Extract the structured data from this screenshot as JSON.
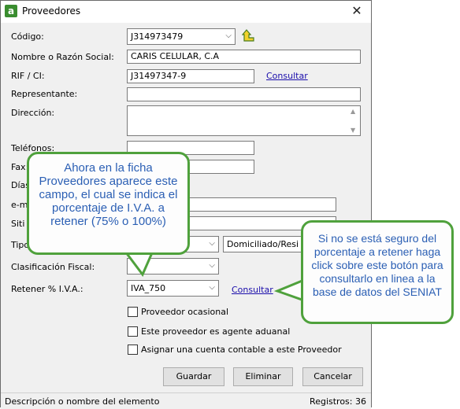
{
  "window": {
    "title": "Proveedores",
    "app_icon_letter": "a",
    "close_glyph": "✕"
  },
  "form": {
    "codigo": {
      "label": "Código:",
      "value": "J314973479"
    },
    "nombre": {
      "label": "Nombre o Razón Social:",
      "value": "CARIS CELULAR, C.A"
    },
    "rif": {
      "label": "RIF / CI:",
      "value": "J31497347-9",
      "link": "Consultar"
    },
    "representante": {
      "label": "Representante:",
      "value": ""
    },
    "direccion": {
      "label": "Dirección:",
      "value": ""
    },
    "telefonos": {
      "label": "Teléfonos:",
      "value": ""
    },
    "fax": {
      "label": "Fax:",
      "value": ""
    },
    "dias": {
      "label": "Días",
      "value": ""
    },
    "email": {
      "label": "e-m",
      "value": ""
    },
    "sitio": {
      "label": "Siti",
      "value": ""
    },
    "tipo": {
      "label": "Tipo",
      "value": "",
      "second_value": "Domiciliado/Resi"
    },
    "clasificacion": {
      "label": "Clasificación Fiscal:",
      "value": ""
    },
    "retener": {
      "label": "Retener % I.V.A.:",
      "value": "IVA_750",
      "link": "Consultar"
    }
  },
  "checkboxes": [
    {
      "label": "Proveedor ocasional",
      "checked": false
    },
    {
      "label": "Este proveedor es agente aduanal",
      "checked": false
    },
    {
      "label": "Asignar una cuenta contable a este Proveedor",
      "checked": false
    }
  ],
  "buttons": {
    "guardar": "Guardar",
    "eliminar": "Eliminar",
    "cancelar": "Cancelar"
  },
  "status": {
    "left": "Descripción o nombre del elemento",
    "right": "Registros: 36"
  },
  "callouts": {
    "left": "Ahora en la ficha Proveedores aparece este campo, el cual se indica el porcentaje de I.V.A. a retener (75% o 100%)",
    "right": "Si no se está seguro del porcentaje a retener haga click sobre este botón para consultarlo en linea a la base de datos del SENIAT"
  },
  "colors": {
    "callout_border": "#4fa13c",
    "callout_text": "#2b5fb4",
    "link": "#1a0dab",
    "accent_icon": "#3a8d2f"
  },
  "icons": {
    "lookup": "arrow-up-yellow-icon"
  }
}
